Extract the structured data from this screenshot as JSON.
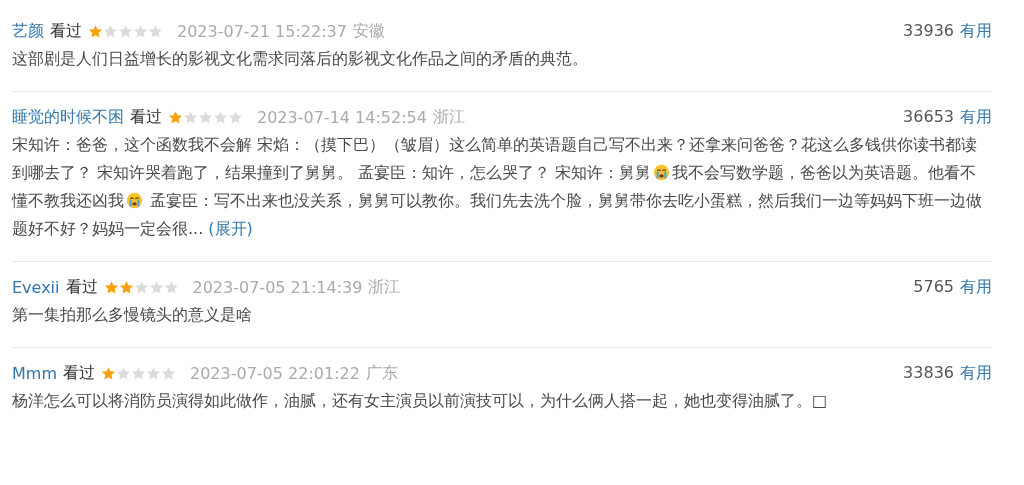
{
  "reviews": [
    {
      "user": "艺颜",
      "status": "看过",
      "stars": 1,
      "time": "2023-07-21 15:22:37",
      "location": "安徽",
      "votes": "33936",
      "vote_label": "有用",
      "body": [
        {
          "kind": "text",
          "text": "这部剧是人们日益增长的影视文化需求同落后的影视文化作品之间的矛盾的典范。"
        }
      ]
    },
    {
      "user": "睡觉的时候不困",
      "status": "看过",
      "stars": 1,
      "time": "2023-07-14 14:52:54",
      "location": "浙江",
      "votes": "36653",
      "vote_label": "有用",
      "body": [
        {
          "kind": "text",
          "text": "宋知许：爸爸，这个函数我不会解 宋焰：（摸下巴）（皱眉）这么简单的英语题自己写不出来？还拿来问爸爸？花这么多钱供你读书都读到哪去了？ 宋知许哭着跑了，结果撞到了舅舅。 孟宴臣：知许，怎么哭了？ 宋知许：舅舅"
        },
        {
          "kind": "emoji"
        },
        {
          "kind": "text",
          "text": "我不会写数学题，爸爸以为英语题。他看不懂不教我还凶我"
        },
        {
          "kind": "emoji"
        },
        {
          "kind": "text",
          "text": " 孟宴臣：写不出来也没关系，舅舅可以教你。我们先去洗个脸，舅舅带你去吃小蛋糕，然后我们一边等妈妈下班一边做题好不好？妈妈一定会很... "
        }
      ],
      "expand": "(展开)"
    },
    {
      "user": "Evexii",
      "status": "看过",
      "stars": 2,
      "time": "2023-07-05 21:14:39",
      "location": "浙江",
      "votes": "5765",
      "vote_label": "有用",
      "body": [
        {
          "kind": "text",
          "text": "第一集拍那么多慢镜头的意义是啥"
        }
      ]
    },
    {
      "user": "Mmm",
      "status": "看过",
      "stars": 1,
      "time": "2023-07-05 22:01:22",
      "location": "广东",
      "votes": "33836",
      "vote_label": "有用",
      "body": [
        {
          "kind": "text",
          "text": "杨洋怎么可以将消防员演得如此做作，油腻，还有女主演员以前演技可以，为什么俩人搭一起，她也变得油腻了。□"
        }
      ]
    }
  ]
}
